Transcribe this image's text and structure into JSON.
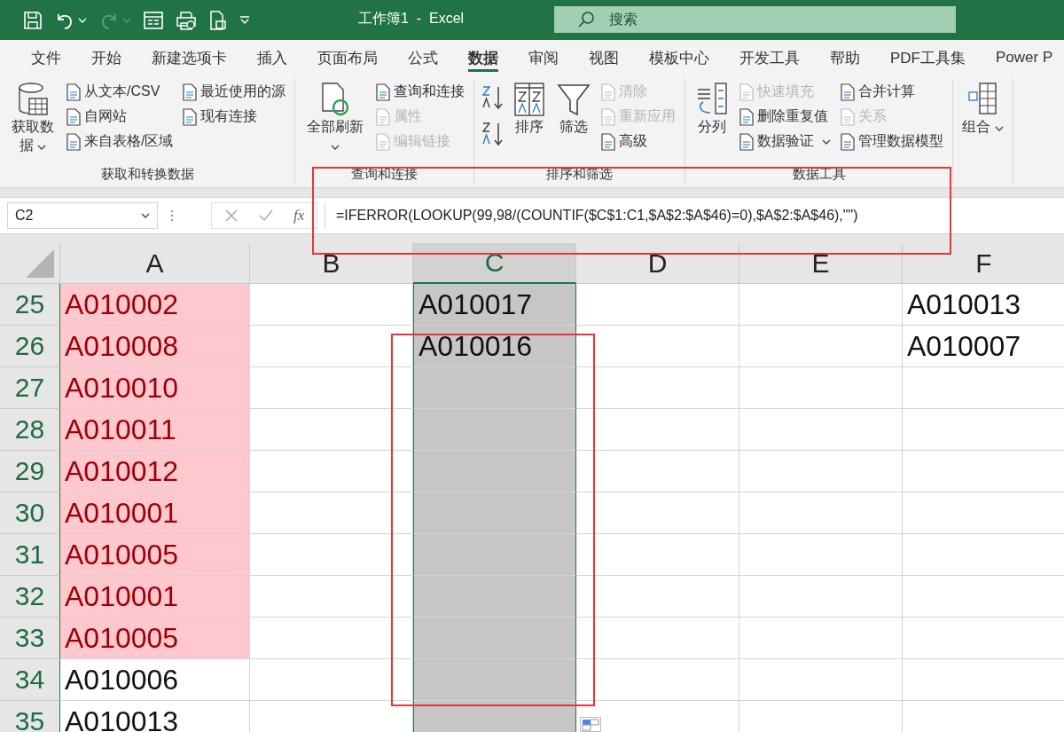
{
  "title_bar": {
    "title": "工作簿1  -  Excel",
    "search": {
      "placeholder": "搜索"
    }
  },
  "tabs": [
    {
      "label": "文件",
      "selected": false
    },
    {
      "label": "开始",
      "selected": false
    },
    {
      "label": "新建选项卡",
      "selected": false
    },
    {
      "label": "插入",
      "selected": false
    },
    {
      "label": "页面布局",
      "selected": false
    },
    {
      "label": "公式",
      "selected": false
    },
    {
      "label": "数据",
      "selected": true
    },
    {
      "label": "审阅",
      "selected": false
    },
    {
      "label": "视图",
      "selected": false
    },
    {
      "label": "模板中心",
      "selected": false
    },
    {
      "label": "开发工具",
      "selected": false
    },
    {
      "label": "帮助",
      "selected": false
    },
    {
      "label": "PDF工具集",
      "selected": false
    },
    {
      "label": "Power P",
      "selected": false
    }
  ],
  "ribbon": {
    "groups": [
      {
        "label": "获取和转换数据",
        "columns": [
          {
            "kind": "large",
            "label": "获取数据",
            "caret": true,
            "disabled": false
          },
          {
            "kind": "stack",
            "items": [
              {
                "label": "从文本/CSV",
                "disabled": false,
                "caret": false
              },
              {
                "label": "自网站",
                "disabled": false,
                "caret": false
              },
              {
                "label": "来自表格/区域",
                "disabled": false,
                "caret": false
              }
            ]
          },
          {
            "kind": "stack",
            "items": [
              {
                "label": "最近使用的源",
                "disabled": false,
                "caret": false
              },
              {
                "label": "现有连接",
                "disabled": false,
                "caret": false
              }
            ]
          }
        ]
      },
      {
        "label": "查询和连接",
        "columns": [
          {
            "kind": "large",
            "label": "全部刷新",
            "caret": true,
            "disabled": false
          },
          {
            "kind": "stack",
            "items": [
              {
                "label": "查询和连接",
                "disabled": false,
                "caret": false
              },
              {
                "label": "属性",
                "disabled": true,
                "caret": false
              },
              {
                "label": "编辑链接",
                "disabled": true,
                "caret": false
              }
            ]
          }
        ]
      },
      {
        "label": "排序和筛选",
        "columns": [
          {
            "kind": "sort"
          },
          {
            "kind": "large",
            "label": "排序",
            "caret": false,
            "disabled": false
          },
          {
            "kind": "large",
            "label": "筛选",
            "caret": false,
            "disabled": false
          },
          {
            "kind": "stack",
            "items": [
              {
                "label": "清除",
                "disabled": true,
                "caret": false
              },
              {
                "label": "重新应用",
                "disabled": true,
                "caret": false
              },
              {
                "label": "高级",
                "disabled": false,
                "caret": false
              }
            ]
          }
        ]
      },
      {
        "label": "数据工具",
        "columns": [
          {
            "kind": "large",
            "label": "分列",
            "caret": false,
            "disabled": false
          },
          {
            "kind": "stack",
            "items": [
              {
                "label": "快速填充",
                "disabled": true,
                "caret": false
              },
              {
                "label": "删除重复值",
                "disabled": false,
                "caret": false
              },
              {
                "label": "数据验证",
                "disabled": false,
                "caret": true
              }
            ]
          },
          {
            "kind": "stack",
            "items": [
              {
                "label": "合并计算",
                "disabled": false,
                "caret": false
              },
              {
                "label": "关系",
                "disabled": true,
                "caret": false
              },
              {
                "label": "管理数据模型",
                "disabled": false,
                "caret": false
              }
            ]
          }
        ]
      },
      {
        "columns": [
          {
            "kind": "large",
            "label": "组合",
            "caret": true,
            "disabled": false
          }
        ]
      }
    ]
  },
  "formula_bar": {
    "name_box": "C2",
    "function_label": "fx",
    "formula": "=IFERROR(LOOKUP(99,98/(COUNTIF($C$1:C1,$A$2:$A$46)=0),$A$2:$A$46),\"\")"
  },
  "sheet": {
    "columns": [
      {
        "label": "A",
        "selected": false
      },
      {
        "label": "B",
        "selected": false
      },
      {
        "label": "C",
        "selected": true
      },
      {
        "label": "D",
        "selected": false
      },
      {
        "label": "E",
        "selected": false
      },
      {
        "label": "F",
        "selected": false
      }
    ],
    "rows": [
      {
        "number": "25",
        "cells": [
          {
            "text": "A010002",
            "highlighted": true
          },
          "",
          {
            "text": "A010017",
            "highlighted": false
          },
          "",
          "",
          {
            "text": "A010013",
            "highlighted": false
          }
        ]
      },
      {
        "number": "26",
        "cells": [
          {
            "text": "A010008",
            "highlighted": true
          },
          "",
          {
            "text": "A010016",
            "highlighted": false
          },
          "",
          "",
          {
            "text": "A010007",
            "highlighted": false
          }
        ]
      },
      {
        "number": "27",
        "cells": [
          {
            "text": "A010010",
            "highlighted": true
          }
        ]
      },
      {
        "number": "28",
        "cells": [
          {
            "text": "A010011",
            "highlighted": true
          }
        ]
      },
      {
        "number": "29",
        "cells": [
          {
            "text": "A010012",
            "highlighted": true
          }
        ]
      },
      {
        "number": "30",
        "cells": [
          {
            "text": "A010001",
            "highlighted": true
          }
        ]
      },
      {
        "number": "31",
        "cells": [
          {
            "text": "A010005",
            "highlighted": true
          }
        ]
      },
      {
        "number": "32",
        "cells": [
          {
            "text": "A010001",
            "highlighted": true
          }
        ]
      },
      {
        "number": "33",
        "cells": [
          {
            "text": "A010005",
            "highlighted": true
          }
        ]
      },
      {
        "number": "34",
        "cells": [
          {
            "text": "A010006",
            "highlighted": false
          }
        ]
      },
      {
        "number": "35",
        "cells": [
          {
            "text": "A010013",
            "highlighted": false
          }
        ]
      }
    ]
  }
}
